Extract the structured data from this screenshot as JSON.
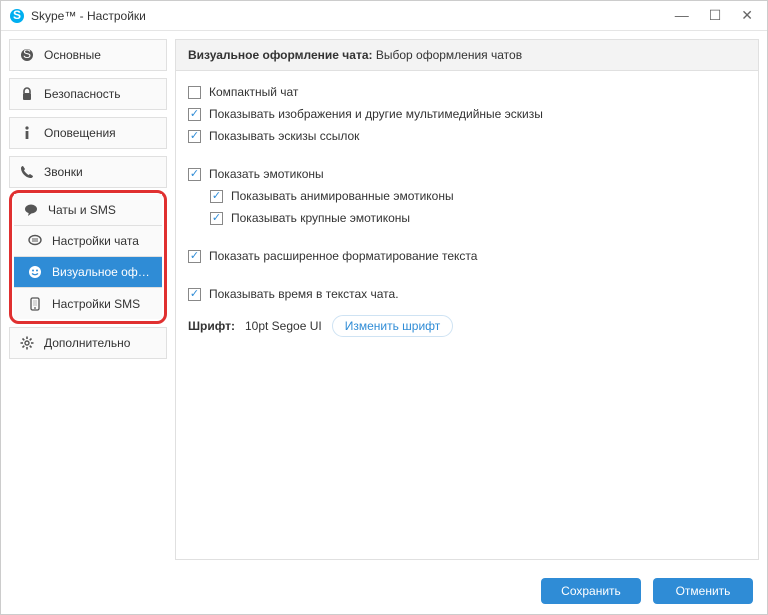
{
  "window": {
    "title": "Skype™ - Настройки"
  },
  "sidebar": {
    "main": [
      {
        "label": "Основные",
        "icon": "skype"
      },
      {
        "label": "Безопасность",
        "icon": "lock"
      },
      {
        "label": "Оповещения",
        "icon": "info"
      },
      {
        "label": "Звонки",
        "icon": "phone"
      }
    ],
    "highlight": [
      {
        "label": "Чаты и SMS",
        "icon": "chat-bubble"
      },
      {
        "label": "Настройки чата",
        "icon": "chat-lines"
      },
      {
        "label": "Визуальное оформле...",
        "icon": "smiley",
        "active": true
      },
      {
        "label": "Настройки SMS",
        "icon": "sms"
      }
    ],
    "extra": {
      "label": "Дополнительно",
      "icon": "gear"
    }
  },
  "header": {
    "bold": "Визуальное оформление чата:",
    "rest": " Выбор оформления чатов"
  },
  "options": {
    "compact": {
      "label": "Компактный чат",
      "checked": false
    },
    "images": {
      "label": "Показывать изображения и другие мультимедийные эскизы",
      "checked": true
    },
    "links": {
      "label": "Показывать эскизы ссылок",
      "checked": true
    },
    "emoti": {
      "label": "Показать эмотиконы",
      "checked": true
    },
    "anim": {
      "label": "Показывать анимированные эмотиконы",
      "checked": true
    },
    "large": {
      "label": "Показывать крупные эмотиконы",
      "checked": true
    },
    "format": {
      "label": "Показать расширенное форматирование текста",
      "checked": true
    },
    "time": {
      "label": "Показывать время в текстах чата.",
      "checked": true
    }
  },
  "font": {
    "label": "Шрифт:",
    "value": "10pt Segoe UI",
    "button": "Изменить шрифт"
  },
  "footer": {
    "save": "Сохранить",
    "cancel": "Отменить"
  }
}
